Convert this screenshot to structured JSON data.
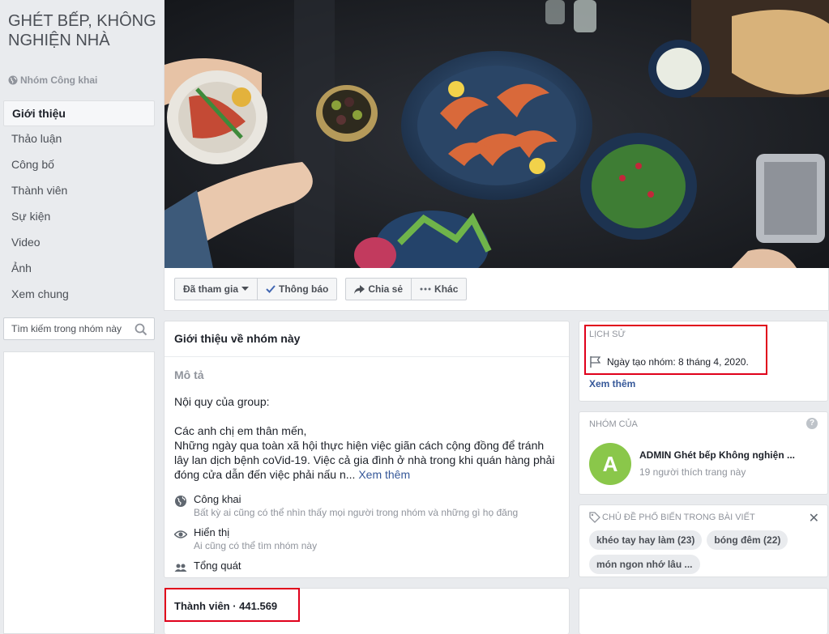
{
  "group": {
    "name": "GHÉT BẾP, KHÔNG NGHIỆN NHÀ",
    "privacy": "Nhóm Công khai"
  },
  "nav": [
    {
      "label": "Giới thiệu",
      "active": true
    },
    {
      "label": "Thảo luận"
    },
    {
      "label": "Công bố"
    },
    {
      "label": "Thành viên"
    },
    {
      "label": "Sự kiện"
    },
    {
      "label": "Video"
    },
    {
      "label": "Ảnh"
    },
    {
      "label": "Xem chung"
    }
  ],
  "search": {
    "placeholder": "Tìm kiếm trong nhóm này"
  },
  "actions": {
    "joined": "Đã tham gia",
    "notify": "Thông báo",
    "share": "Chia sẻ",
    "more": "Khác"
  },
  "about": {
    "header": "Giới thiệu về nhóm này",
    "desc_title": "Mô tả",
    "desc": "Nội quy của group:\n\nCác anh chị em thân mến,\nNhững ngày qua toàn xã hội thực hiện việc giãn cách cộng đồng để tránh lây lan dịch bệnh coVid-19. Việc cả gia đình ở nhà trong khi quán hàng phải đóng cửa dẫn đến việc phải nấu n...",
    "see_more": "Xem thêm",
    "items": [
      {
        "title": "Công khai",
        "sub": "Bất kỳ ai cũng có thể nhìn thấy mọi người trong nhóm và những gì họ đăng",
        "icon": "globe-icon"
      },
      {
        "title": "Hiển thị",
        "sub": "Ai cũng có thể tìm nhóm này",
        "icon": "eye-icon"
      },
      {
        "title": "Tổng quát",
        "icon": "people-icon"
      }
    ]
  },
  "members": {
    "title": "Thành viên · 441.569"
  },
  "history": {
    "head": "LỊCH SỬ",
    "created": "Ngày tạo nhóm: 8 tháng 4, 2020.",
    "see_more": "Xem thêm"
  },
  "owner": {
    "head": "NHÓM CỦA",
    "help": "?",
    "avatar_letter": "A",
    "name": "ADMIN Ghét bếp Không nghiện ...",
    "likes": "19 người thích trang này"
  },
  "topics": {
    "head": "CHỦ ĐỀ PHỔ BIẾN TRONG BÀI VIẾT",
    "chips": [
      "khéo tay hay làm (23)",
      "bóng đêm (22)",
      "món ngon nhớ lâu ..."
    ]
  },
  "colors": {
    "link": "#365899",
    "highlight": "#e0001b",
    "avatar": "#8ac74a"
  }
}
